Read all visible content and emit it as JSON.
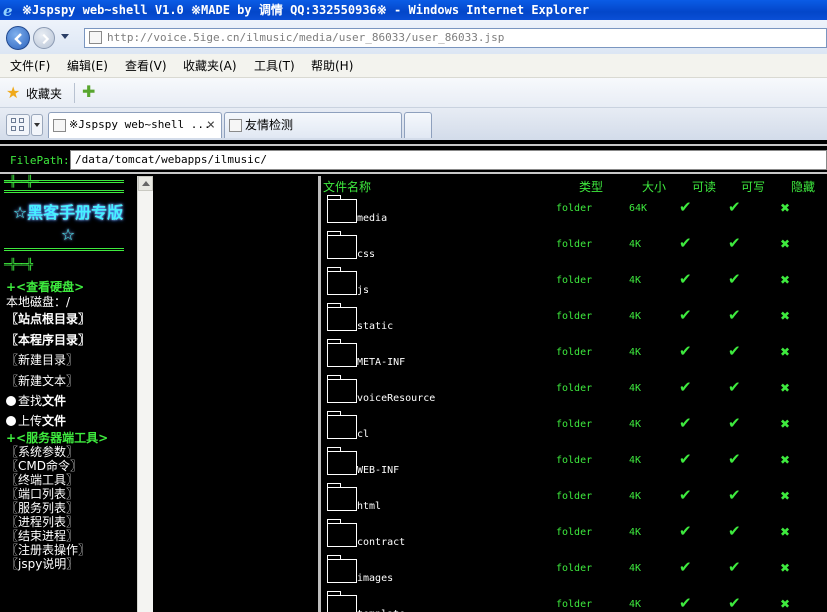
{
  "window": {
    "title": "※Jspspy web~shell V1.0 ※MADE by 调情 QQ:332550936※ - Windows Internet Explorer",
    "address": "http://voice.5ige.cn/ilmusic/media/user_86033/user_86033.jsp"
  },
  "menu": [
    "文件(F)",
    "编辑(E)",
    "查看(V)",
    "收藏夹(A)",
    "工具(T)",
    "帮助(H)"
  ],
  "favorites": {
    "label": "收藏夹"
  },
  "tabs": [
    {
      "label": "※Jspspy web~shell ...",
      "active": true,
      "close": "×"
    },
    {
      "label": "友情检测",
      "active": false
    }
  ],
  "filepath": {
    "label": "FilePath:",
    "value": "/data/tomcat/webapps/ilmusic/"
  },
  "sidebar": {
    "deco_top": "═╬══╬═",
    "brand_line1": "☆黑客手册专版",
    "brand_line2": "☆",
    "deco_bottom": "═╬══╬",
    "disk_heading": "+<查看硬盘>",
    "local_disk": "本地磁盘：/",
    "site_root": "〖站点根目录〗",
    "program_dir": "〖本程序目录〗",
    "new_dir": "〖新建目录〗",
    "new_text": "〖新建文本〗",
    "find_file_prefix": "查找",
    "find_file_bold": "文件",
    "upload_prefix": "上传",
    "upload_bold": "文件",
    "server_tools_heading": "+<服务器端工具>",
    "tools": [
      "〖系统参数〗",
      "〖CMD命令〗",
      "〖终端工具〗",
      "〖端口列表〗",
      "〖服务列表〗",
      "〖进程列表〗",
      "〖结束进程〗",
      "〖注册表操作〗",
      "〖jspy说明〗"
    ]
  },
  "table": {
    "headers": {
      "name": "文件名称",
      "type": "类型",
      "size": "大小",
      "read": "可读",
      "write": "可写",
      "hidden": "隐藏"
    },
    "check_glyph": "✔",
    "cross_glyph": "✖",
    "rows": [
      {
        "name": "media",
        "type": "folder",
        "size": "64K"
      },
      {
        "name": "css",
        "type": "folder",
        "size": "4K"
      },
      {
        "name": "js",
        "type": "folder",
        "size": "4K"
      },
      {
        "name": "static",
        "type": "folder",
        "size": "4K"
      },
      {
        "name": "META-INF",
        "type": "folder",
        "size": "4K"
      },
      {
        "name": "voiceResource",
        "type": "folder",
        "size": "4K"
      },
      {
        "name": "cl",
        "type": "folder",
        "size": "4K"
      },
      {
        "name": "WEB-INF",
        "type": "folder",
        "size": "4K"
      },
      {
        "name": "html",
        "type": "folder",
        "size": "4K"
      },
      {
        "name": "contract",
        "type": "folder",
        "size": "4K"
      },
      {
        "name": "images",
        "type": "folder",
        "size": "4K"
      },
      {
        "name": "template",
        "type": "folder",
        "size": "4K"
      }
    ]
  }
}
